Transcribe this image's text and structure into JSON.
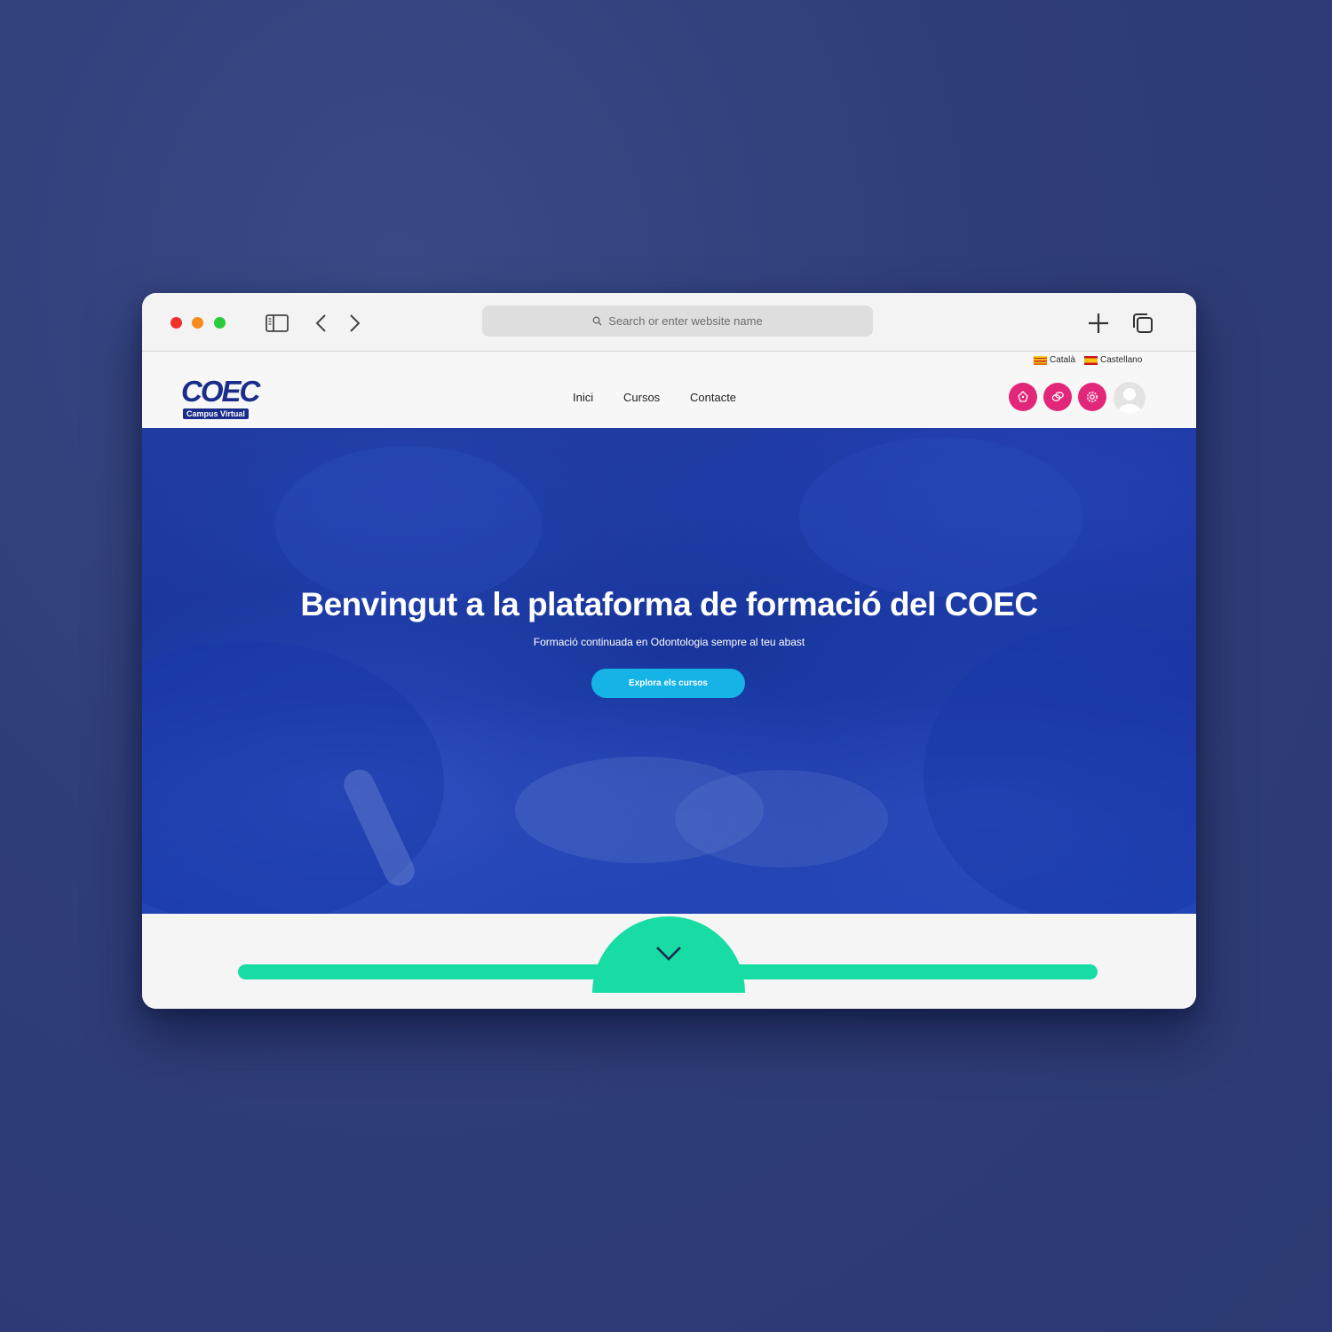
{
  "browser": {
    "address_placeholder": "Search or enter website name"
  },
  "site": {
    "languages": [
      {
        "label": "Català"
      },
      {
        "label": "Castellano"
      }
    ],
    "logo": {
      "word": "COEC",
      "tagline": "Campus Virtual"
    },
    "nav": [
      {
        "label": "Inici"
      },
      {
        "label": "Cursos"
      },
      {
        "label": "Contacte"
      }
    ],
    "header_icons": [
      "notification-icon",
      "messages-icon",
      "settings-icon"
    ],
    "hero": {
      "title": "Benvingut a la plataforma de formació del COEC",
      "subtitle": "Formació continuada en Odontologia sempre al teu abast",
      "cta_label": "Explora els cursos"
    },
    "cards": [
      {
        "icon": "graduation-globe-icon"
      },
      {
        "icon": "shield-check-icon"
      }
    ]
  },
  "colors": {
    "brand_blue": "#1b2d8a",
    "accent_pink": "#e2277a",
    "cta_blue": "#16b3e6",
    "accent_green": "#17dca4"
  }
}
